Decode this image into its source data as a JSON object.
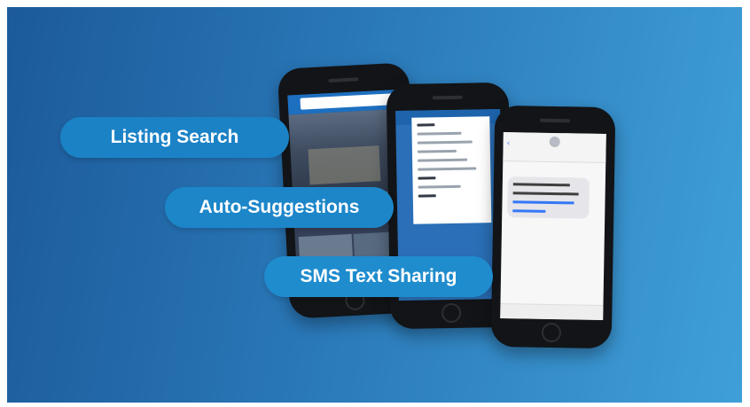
{
  "banner": {
    "features": [
      {
        "label": "Listing Search"
      },
      {
        "label": "Auto-Suggestions"
      },
      {
        "label": "SMS Text Sharing"
      }
    ]
  },
  "colors": {
    "gradient_start": "#1c5a9a",
    "gradient_end": "#3f9fd8",
    "pill": "#1e88c8",
    "phone_body": "#121417"
  },
  "icons": [
    "search-icon",
    "back-chevron-icon",
    "contact-avatar-icon",
    "home-button-icon"
  ]
}
